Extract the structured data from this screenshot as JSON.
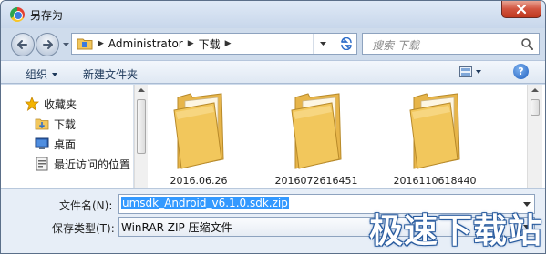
{
  "window": {
    "title": "另存为"
  },
  "address": {
    "crumbs": [
      "Administrator",
      "下载"
    ],
    "search_placeholder": "搜索 下载"
  },
  "toolbar": {
    "organize_label": "组织",
    "new_folder_label": "新建文件夹"
  },
  "nav_pane": {
    "items": [
      {
        "label": "收藏夹",
        "icon": "star-icon"
      },
      {
        "label": "下载",
        "icon": "download-folder-icon"
      },
      {
        "label": "桌面",
        "icon": "desktop-icon"
      },
      {
        "label": "最近访问的位置",
        "icon": "recent-places-icon"
      }
    ]
  },
  "files": [
    {
      "name": "2016.06.26"
    },
    {
      "name": "2016072616451"
    },
    {
      "name": "2016110618440"
    }
  ],
  "form": {
    "filename_label": "文件名(N):",
    "filename_value": "umsdk_Android_v6.1.0.sdk.zip",
    "filetype_label": "保存类型(T):",
    "filetype_value": "WinRAR ZIP 压缩文件"
  },
  "watermark": "极速下载站",
  "colors": {
    "accent": "#3399ff",
    "folder": "#f2c75c",
    "title_bar": "#cfdcec"
  }
}
